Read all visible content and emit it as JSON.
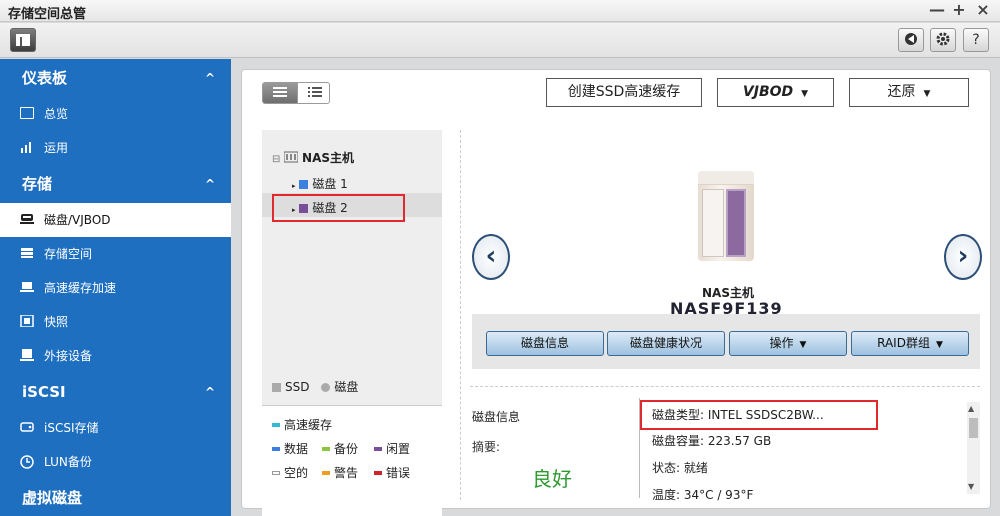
{
  "window": {
    "title": "存储空间总管",
    "minimize": "—",
    "maximize": "+",
    "close": "×"
  },
  "toolbar": {
    "help_label": "?"
  },
  "sidebar": {
    "sections": [
      {
        "title": "仪表板",
        "items": [
          {
            "label": "总览",
            "icon": "overview-icon"
          },
          {
            "label": "运用",
            "icon": "chart-icon"
          }
        ]
      },
      {
        "title": "存储",
        "items": [
          {
            "label": "磁盘/VJBOD",
            "icon": "disk-icon",
            "active": true
          },
          {
            "label": "存储空间",
            "icon": "storage-icon"
          },
          {
            "label": "高速缓存加速",
            "icon": "cache-icon"
          },
          {
            "label": "快照",
            "icon": "snapshot-icon"
          },
          {
            "label": "外接设备",
            "icon": "external-device-icon"
          }
        ]
      },
      {
        "title": "iSCSI",
        "items": [
          {
            "label": "iSCSI存储",
            "icon": "iscsi-icon"
          },
          {
            "label": "LUN备份",
            "icon": "lun-backup-icon"
          }
        ]
      },
      {
        "title": "虚拟磁盘",
        "items": []
      }
    ]
  },
  "main": {
    "buttons": {
      "create_ssd_cache": "创建SSD高速缓存",
      "vjbod": "VJBOD",
      "restore": "还原"
    },
    "tree": {
      "root": "NAS主机",
      "disks": [
        {
          "label": "磁盘 1",
          "color": "#3b7fe0"
        },
        {
          "label": "磁盘 2",
          "color": "#7a4f9a"
        }
      ],
      "type_legend": {
        "ssd": "SSD",
        "disk": "磁盘"
      },
      "status_legend": {
        "cache": "高速缓存",
        "data": "数据",
        "backup": "备份",
        "idle": "闲置",
        "empty": "空的",
        "warning": "警告",
        "error": "错误"
      }
    },
    "nas": {
      "label": "NAS主机",
      "name": "NASF9F139"
    },
    "actions": {
      "disk_info": "磁盘信息",
      "disk_health": "磁盘健康状况",
      "operation": "操作",
      "raid_group": "RAID群组"
    },
    "info": {
      "title": "磁盘信息",
      "summary_label": "摘要:",
      "summary_value": "良好",
      "rows": [
        "磁盘类型:  INTEL SSDSC2BW...",
        "磁盘容量:  223.57 GB",
        "状态:  就绪",
        "温度:  34°C / 93°F"
      ]
    },
    "colors": {
      "cache": "#31bcd2",
      "data": "#3b7fe0",
      "backup": "#8cc63f",
      "idle": "#7a4f9a",
      "warning": "#f39c22",
      "error": "#d2232a",
      "accent": "#1f6fc1"
    }
  }
}
